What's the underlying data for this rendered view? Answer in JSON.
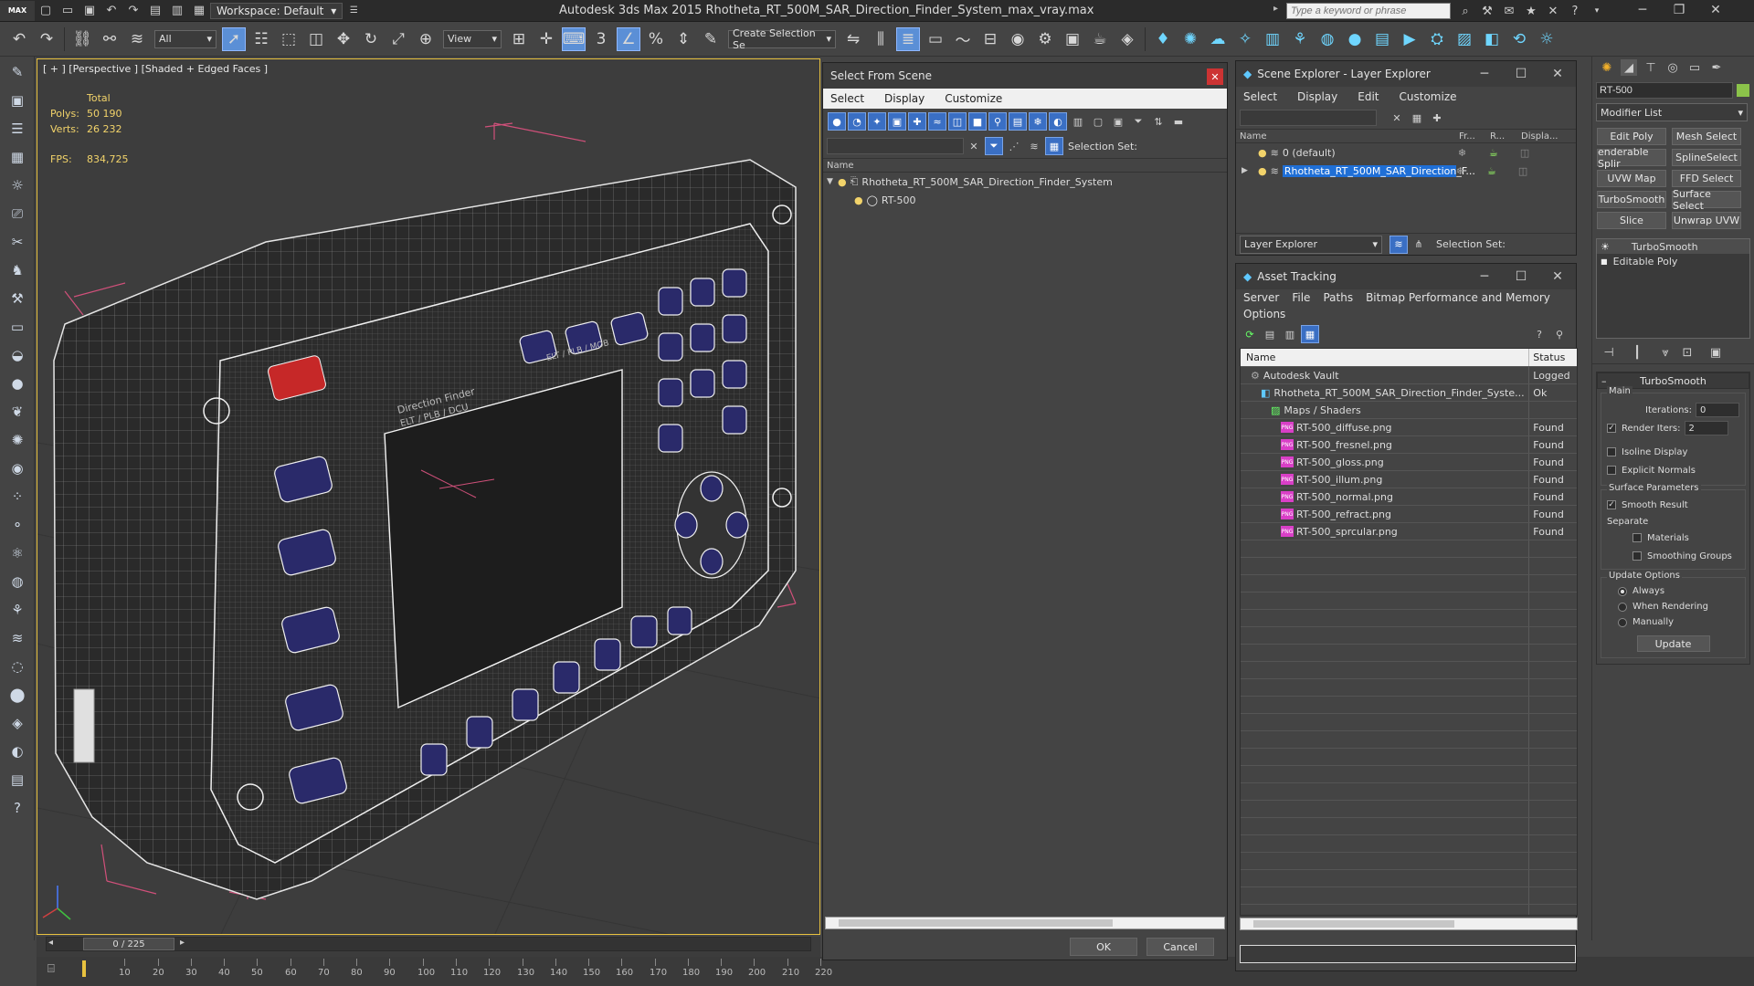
{
  "titlebar": {
    "app_icon_label": "MAX",
    "workspace": "Workspace: Default",
    "title": "Autodesk 3ds Max  2015      Rhotheta_RT_500M_SAR_Direction_Finder_System_max_vray.max",
    "search_placeholder": "Type a keyword or phrase"
  },
  "main_toolbar": {
    "selection_filter": "All",
    "ref_coord": "View",
    "named_selection": "Create Selection Se"
  },
  "viewport": {
    "label": "[ + ] [Perspective ] [Shaded + Edged Faces ]",
    "stats": {
      "total_label": "Total",
      "polys_label": "Polys:",
      "polys": "50 190",
      "verts_label": "Verts:",
      "verts": "26 232",
      "fps_label": "FPS:",
      "fps": "834,725"
    },
    "device_text": {
      "label_top": "ELT / PLB / MOB",
      "label_mid": "Direction Finder",
      "label_bot": "ELT / PLB / DCU"
    }
  },
  "timeline": {
    "frame": "0 / 225",
    "ticks": [
      "10",
      "20",
      "30",
      "40",
      "50",
      "60",
      "70",
      "80",
      "90",
      "100",
      "110",
      "120",
      "130",
      "140",
      "150",
      "160",
      "170",
      "180",
      "190",
      "200",
      "210",
      "220"
    ]
  },
  "select_from_scene": {
    "title": "Select From Scene",
    "menus": [
      "Select",
      "Display",
      "Customize"
    ],
    "selection_set_label": "Selection Set:",
    "column_name": "Name",
    "tree": [
      {
        "name": "Rhotheta_RT_500M_SAR_Direction_Finder_System",
        "level": 0
      },
      {
        "name": "RT-500",
        "level": 1
      }
    ],
    "ok": "OK",
    "cancel": "Cancel"
  },
  "scene_explorer": {
    "title": "Scene Explorer - Layer Explorer",
    "menus": [
      "Select",
      "Display",
      "Edit",
      "Customize"
    ],
    "columns": [
      "Name",
      "Fr...",
      "R...",
      "Displa..."
    ],
    "layers": [
      {
        "name": "0 (default)",
        "selected": false
      },
      {
        "name": "Rhotheta_RT_500M_SAR_Direction_F...",
        "selected": true
      }
    ],
    "explorer_dropdown": "Layer Explorer",
    "selection_set_label": "Selection Set:"
  },
  "asset_tracking": {
    "title": "Asset Tracking",
    "menus": [
      "Server",
      "File",
      "Paths",
      "Bitmap Performance and Memory"
    ],
    "menu_options": "Options",
    "columns": {
      "name": "Name",
      "status": "Status"
    },
    "rows": [
      {
        "name": "Autodesk Vault",
        "status": "Logged",
        "indent": 1,
        "kind": "vault"
      },
      {
        "name": "Rhotheta_RT_500M_SAR_Direction_Finder_Syste...",
        "status": "Ok",
        "indent": 2,
        "kind": "max"
      },
      {
        "name": "Maps / Shaders",
        "status": "",
        "indent": 3,
        "kind": "folder"
      },
      {
        "name": "RT-500_diffuse.png",
        "status": "Found",
        "indent": 4,
        "kind": "png"
      },
      {
        "name": "RT-500_fresnel.png",
        "status": "Found",
        "indent": 4,
        "kind": "png"
      },
      {
        "name": "RT-500_gloss.png",
        "status": "Found",
        "indent": 4,
        "kind": "png"
      },
      {
        "name": "RT-500_illum.png",
        "status": "Found",
        "indent": 4,
        "kind": "png"
      },
      {
        "name": "RT-500_normal.png",
        "status": "Found",
        "indent": 4,
        "kind": "png"
      },
      {
        "name": "RT-500_refract.png",
        "status": "Found",
        "indent": 4,
        "kind": "png"
      },
      {
        "name": "RT-500_sprcular.png",
        "status": "Found",
        "indent": 4,
        "kind": "png"
      }
    ],
    "png_badge": "PNG"
  },
  "command_panel": {
    "object_name": "RT-500",
    "modifier_list": "Modifier List",
    "modifier_buttons": [
      "Edit Poly",
      "Mesh Select",
      "enderable Splir",
      "SplineSelect",
      "UVW Map",
      "FFD Select",
      "TurboSmooth",
      "Surface Select",
      "Slice",
      "Unwrap UVW"
    ],
    "stack": [
      {
        "name": "TurboSmooth",
        "active": true
      },
      {
        "name": "Editable Poly",
        "active": false
      }
    ],
    "turbosmooth": {
      "title": "TurboSmooth",
      "main_label": "Main",
      "iterations_label": "Iterations:",
      "iterations": "0",
      "render_iters_label": "Render Iters:",
      "render_iters": "2",
      "isoline": "Isoline Display",
      "explicit": "Explicit Normals",
      "surface_params": "Surface Parameters",
      "smooth_result": "Smooth Result",
      "separate": "Separate",
      "materials": "Materials",
      "smoothing_groups": "Smoothing Groups",
      "update_options": "Update Options",
      "always": "Always",
      "when_rendering": "When Rendering",
      "manually": "Manually",
      "update": "Update"
    }
  },
  "colors": {
    "selection_blue": "#1f6fd6",
    "viewport_border": "#e8c23f",
    "stats_yellow": "#f2d36a"
  }
}
